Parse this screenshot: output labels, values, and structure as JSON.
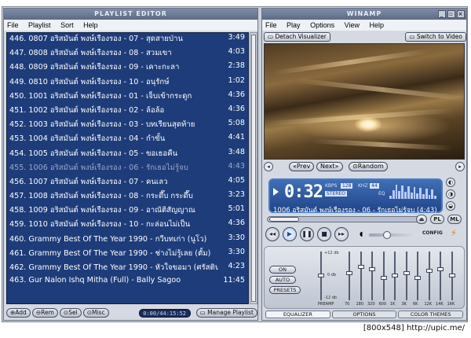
{
  "playlist": {
    "title": "PLAYLIST EDITOR",
    "menu": [
      "File",
      "Playlist",
      "Sort",
      "Help"
    ],
    "rows": [
      {
        "text": "446. 0807 อริสมันต์ พงษ์เรืองรอง - 07 - สุดสายป่าน",
        "dur": "3:49"
      },
      {
        "text": "447. 0808 อริสมันต์ พงษ์เรืองรอง - 08 - สวมเขา",
        "dur": "4:03"
      },
      {
        "text": "448. 0809 อริสมันต์ พงษ์เรืองรอง - 09 - เคาะกะลา",
        "dur": "2:38"
      },
      {
        "text": "449. 0810 อริสมันต์ พงษ์เรืองรอง - 10 - อนุรักษ์",
        "dur": "1:02"
      },
      {
        "text": "450. 1001 อริสมันต์ พงษ์เรืองรอง - 01 - เจ็บเข้ากระดูก",
        "dur": "4:36"
      },
      {
        "text": "451. 1002 อริสมันต์ พงษ์เรืองรอง - 02 - ล้อล้อ",
        "dur": "4:36"
      },
      {
        "text": "452. 1003 อริสมันต์ พงษ์เรืองรอง - 03 - บทเรียนสุดท้าย",
        "dur": "5:08"
      },
      {
        "text": "453. 1004 อริสมันต์ พงษ์เรืองรอง - 04 - กำขั้น",
        "dur": "4:41"
      },
      {
        "text": "454. 1005 อริสมันต์ พงษ์เรืองรอง - 05 - ขอเธอคืน",
        "dur": "3:48"
      },
      {
        "text": "455. 1006 อริสมันต์ พงษ์เรืองรอง - 06 - รักเธอไม่รู้จบ",
        "dur": "4:43"
      },
      {
        "text": "456. 1007 อริสมันต์ พงษ์เรืองรอง - 07 - คนเลว",
        "dur": "4:05"
      },
      {
        "text": "457. 1008 อริสมันต์ พงษ์เรืองรอง - 08 - กระดึ๊บ กระดึ๊บ",
        "dur": "3:23"
      },
      {
        "text": "458. 1009 อริสมันต์ พงษ์เรืองรอง - 09 - อาณัติสัญญาณ",
        "dur": "5:01"
      },
      {
        "text": "459. 1010 อริสมันต์ พงษ์เรืองรอง - 10 - กะล่อนไม่เป็น",
        "dur": "4:36"
      },
      {
        "text": "460. Grammy Best Of The Year 1990 - กวีบทเก่า (นูโว)",
        "dur": "3:30"
      },
      {
        "text": "461. Grammy Best Of The Year 1990 - ช่างไม่รู้เลย (ตั้ม)",
        "dur": "3:30"
      },
      {
        "text": "462. Grammy Best Of The Year 1990 - หัวใจขอมา (ศรัสตินา)",
        "dur": "4:23"
      },
      {
        "text": "463. Gur Nalon Ishq Mitha (Full) - Bally Sagoo",
        "dur": "11:45"
      }
    ],
    "current_index": 9,
    "footer": {
      "add": "Add",
      "rem": "Rem",
      "sel": "Sel",
      "misc": "Misc",
      "time": "0:00/44:15:52",
      "manage": "Manage Playlist"
    }
  },
  "winamp": {
    "title": "WINAMP",
    "menu": [
      "File",
      "Play",
      "Options",
      "View",
      "Help"
    ],
    "detach": "Detach Visualizer",
    "switch": "Switch to Video",
    "prev": "Prev",
    "next": "Next",
    "random": "Random",
    "time": "0:32",
    "kbps": "KBPS",
    "kbps_val": "128",
    "khz": "KHZ",
    "khz_val": "44",
    "stereo": "STEREO",
    "eq": "EQ",
    "song": "1006 อริสมันต์ พงษ์เรืองรอง - 06 - รักเธอไม่รู้จบ (4:43)",
    "pl_btn": "PL",
    "ml_btn": "ML",
    "config": "CONFIG",
    "eq_on": "ON",
    "eq_auto": "AUTO",
    "eq_presets": "PRESETS",
    "db_top": "+12 db",
    "db_mid": "0 db",
    "db_bot": "-12 db",
    "preamp": "PREAMP",
    "bands": [
      "70",
      "180",
      "320",
      "600",
      "1K",
      "3K",
      "6K",
      "12K",
      "14K",
      "16K"
    ],
    "band_levels": [
      0.55,
      0.7,
      0.65,
      0.45,
      0.5,
      0.55,
      0.45,
      0.6,
      0.65,
      0.5
    ],
    "preamp_level": 0.5,
    "tabs": [
      "EQUALIZER",
      "OPTIONS",
      "COLOR THEMES"
    ]
  },
  "caption": "[800x548] http://upic.me/"
}
